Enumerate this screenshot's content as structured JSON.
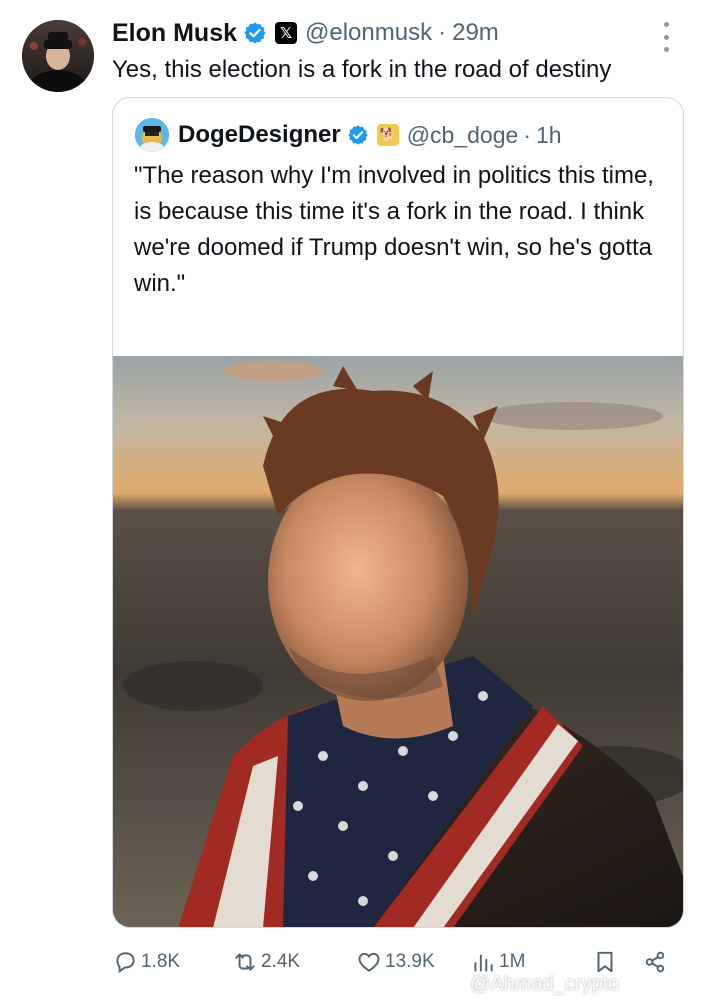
{
  "tweet": {
    "author_name": "Elon Musk",
    "handle": "@elonmusk",
    "separator": "·",
    "time": "29m",
    "text": "Yes, this election is a fork in the road of destiny",
    "badge_icon": "verified-badge-icon",
    "affiliation_icon": "x-logo-icon"
  },
  "quote": {
    "author_name": "DogeDesigner",
    "handle": "@cb_doge",
    "separator": "·",
    "time": "1h",
    "text": "\"The reason why I'm involved in politics this time, is because this time it's a fork in the road. I think we're doomed if Trump doesn't win, so he's gotta win.\"",
    "ellipsis": "...",
    "affiliation_icon": "doge-icon"
  },
  "actions": {
    "replies": "1.8K",
    "reposts": "2.4K",
    "likes": "13.9K",
    "views": "1M"
  },
  "watermark": "@Ahmad_crypto",
  "colors": {
    "verified_blue": "#1d9bf0",
    "muted_text": "#536471",
    "border": "#cfd9de"
  }
}
